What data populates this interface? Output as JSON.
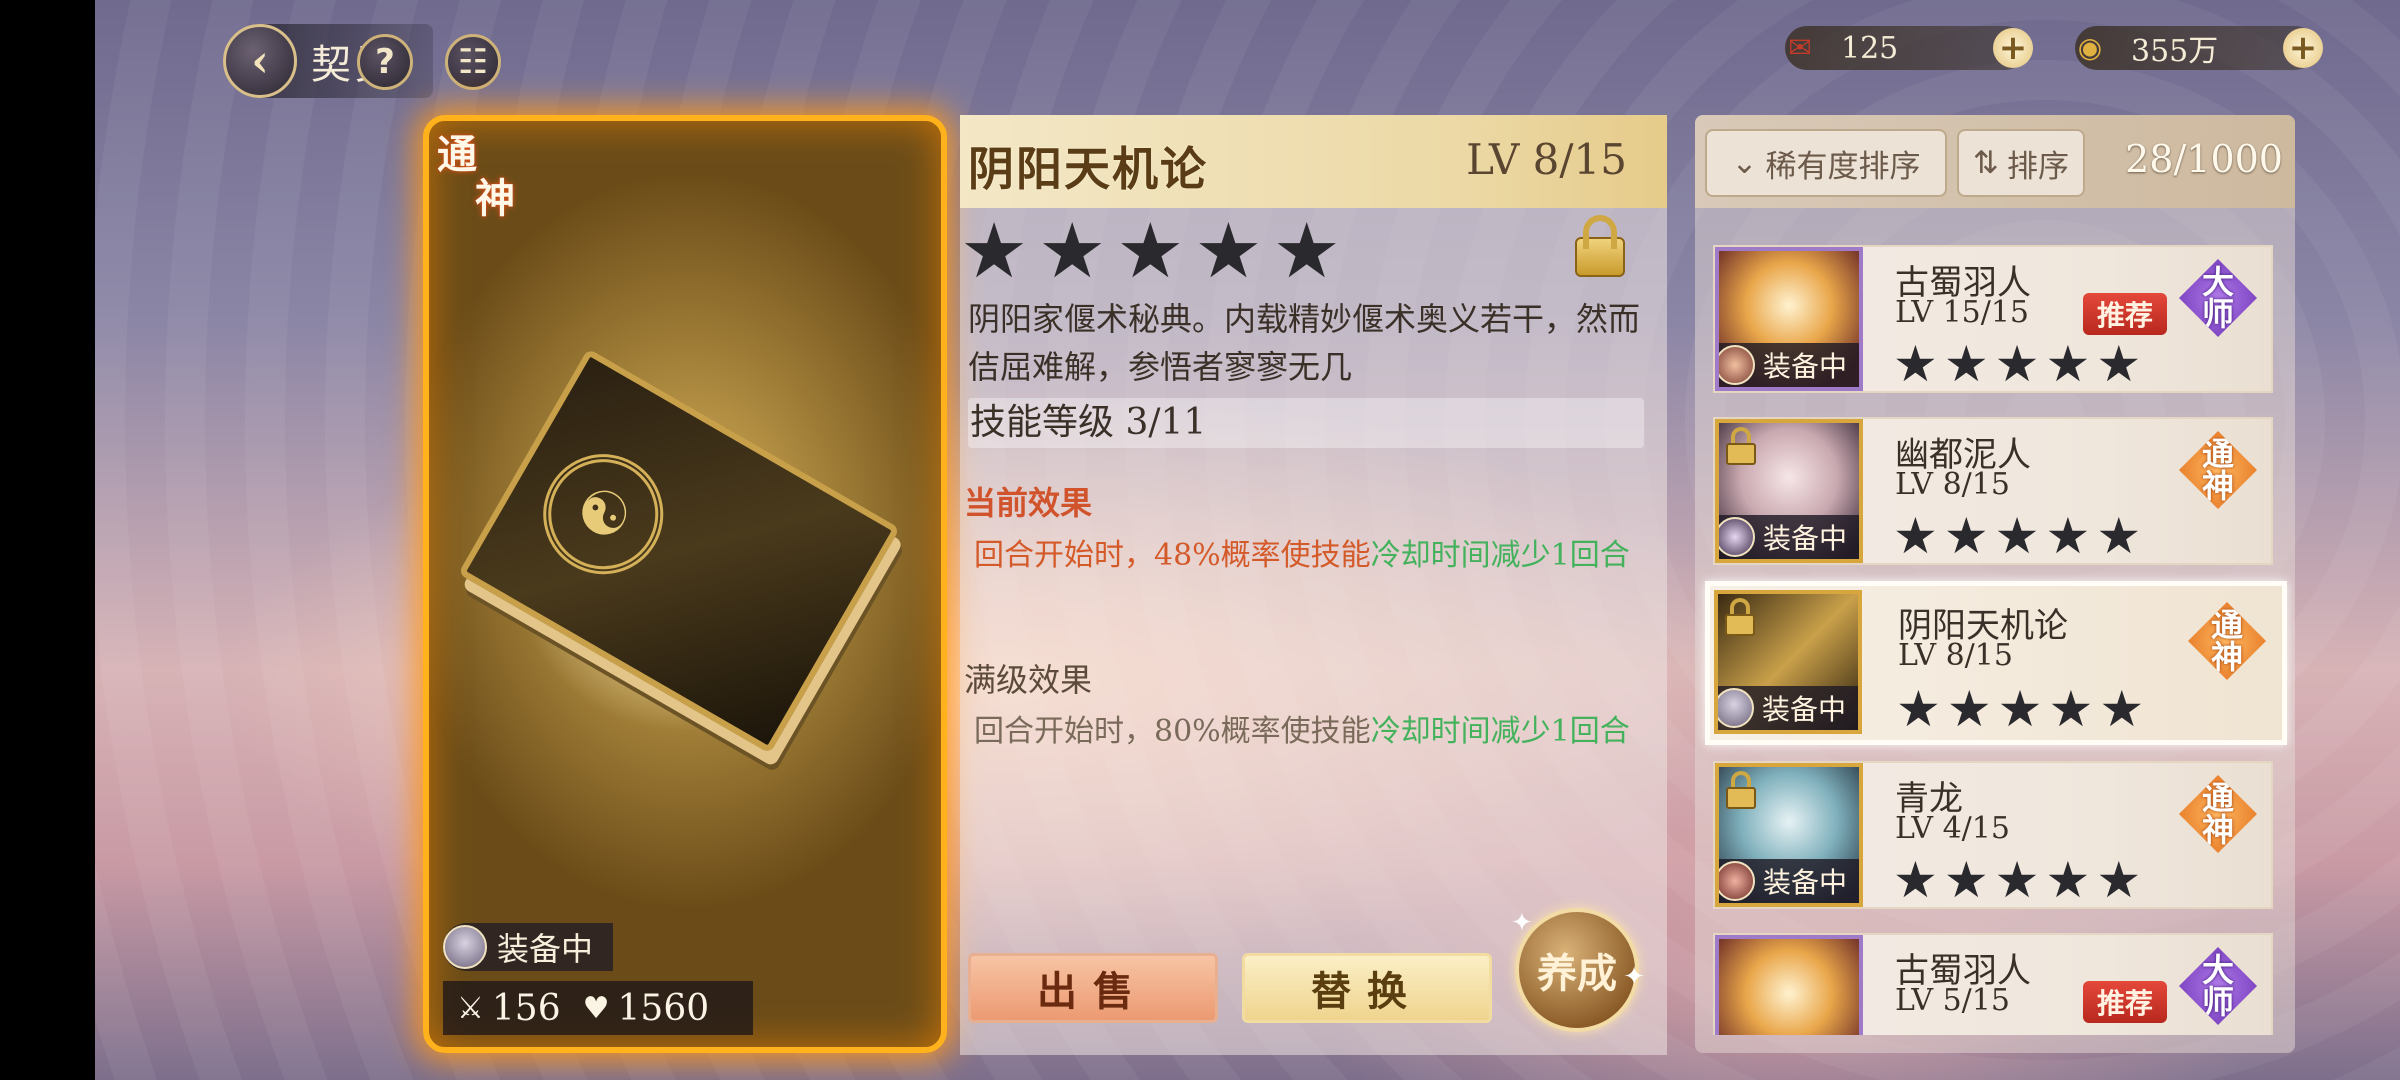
{
  "top": {
    "back_label": "契灵",
    "back_icon": "chevron-left-icon",
    "help_icon": "question-mark-icon",
    "chat_icon": "chat-bubble-icon",
    "help_glyph": "?",
    "chat_glyph": "☷",
    "resources": [
      {
        "icon": "ticket-icon",
        "glyph": "✉",
        "value": "125"
      },
      {
        "icon": "coin-icon",
        "glyph": "◉",
        "value": "355万"
      }
    ],
    "plus_glyph": "+"
  },
  "card": {
    "rarity_line1": "通",
    "rarity_line2": "神",
    "equip_label": "装备中",
    "attack_icon": "sword-icon",
    "attack_glyph": "⚔",
    "attack": "156",
    "hp_icon": "heart-icon",
    "hp_glyph": "♥",
    "hp": "1560",
    "bagua_glyph": "☯"
  },
  "detail": {
    "name": "阴阳天机论",
    "level": "LV 8/15",
    "star_count": 5,
    "locked": true,
    "description": "阴阳家偃术秘典。内载精妙偃术奥义若干，然而佶屈难解，参悟者寥寥无几",
    "skill_level": "技能等级 3/11",
    "current_effect_title": "当前效果",
    "current_effect_a": "回合开始时，48%概率使技能",
    "current_effect_b": "冷却时间减少1回合",
    "max_effect_title": "满级效果",
    "max_effect_a": "回合开始时，80%概率使技能",
    "max_effect_b": "冷却时间减少1回合",
    "sell_label": "出售",
    "swap_label": "替换",
    "train_label": "养成"
  },
  "list": {
    "sort_rarity_label": "稀有度排序",
    "sort_order_label": "排序",
    "count": "28/1000",
    "items": [
      {
        "name": "古蜀羽人",
        "level": "LV 15/15",
        "rarity_line1": "大",
        "rarity_line2": "师",
        "rarity": "dashi",
        "recommend": "推荐",
        "equip": "装备中",
        "locked": false,
        "selected": false
      },
      {
        "name": "幽都泥人",
        "level": "LV 8/15",
        "rarity_line1": "通",
        "rarity_line2": "神",
        "rarity": "tongshen",
        "recommend": "",
        "equip": "装备中",
        "locked": true,
        "selected": false
      },
      {
        "name": "阴阳天机论",
        "level": "LV 8/15",
        "rarity_line1": "通",
        "rarity_line2": "神",
        "rarity": "tongshen",
        "recommend": "",
        "equip": "装备中",
        "locked": true,
        "selected": true
      },
      {
        "name": "青龙",
        "level": "LV 4/15",
        "rarity_line1": "通",
        "rarity_line2": "神",
        "rarity": "tongshen",
        "recommend": "",
        "equip": "装备中",
        "locked": true,
        "selected": false
      },
      {
        "name": "古蜀羽人",
        "level": "LV 5/15",
        "rarity_line1": "大",
        "rarity_line2": "师",
        "rarity": "dashi",
        "recommend": "推荐",
        "equip": "",
        "locked": false,
        "selected": false
      }
    ]
  },
  "colors": {
    "card_glow": "#ffb21c",
    "effect_orange": "#d45a2a",
    "effect_green": "#44b25c",
    "rarity_purple": "#8a4ad0",
    "rarity_orange": "#e8781e"
  }
}
